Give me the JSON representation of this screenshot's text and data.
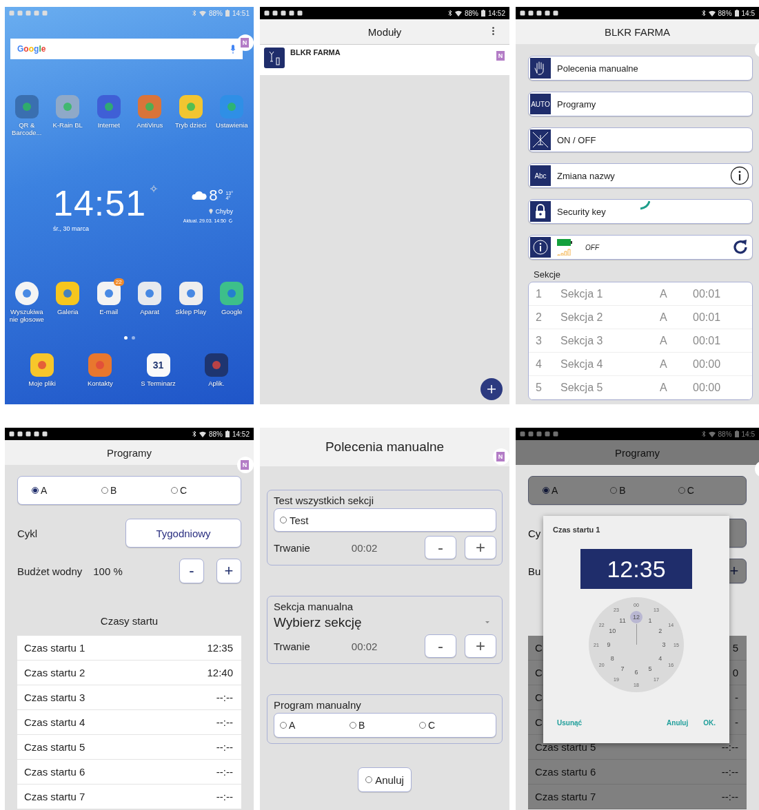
{
  "home_screen": {
    "status_bar": {
      "battery": "88%",
      "time": "14:51"
    },
    "overlay_bubble": "N",
    "search": {
      "logo": "Google"
    },
    "apps": [
      {
        "label": "QR &\nBarcode...",
        "color": "#3a6fb0"
      },
      {
        "label": "K-Rain BL",
        "color": "#8fa9c8"
      },
      {
        "label": "Internet",
        "color": "#3f5fd6"
      },
      {
        "label": "AntiVirus",
        "color": "#d9743a"
      },
      {
        "label": "Tryb dzieci",
        "color": "#f2c531"
      },
      {
        "label": "Ustawienia",
        "color": "#2f8fe6"
      }
    ],
    "clock": {
      "time": "14:51",
      "date": "śr., 30 marca"
    },
    "weather": {
      "temperature": "8°",
      "high": "13°",
      "low": "4°",
      "location": "Chyby",
      "updated": "Aktual. 29.03. 14:50"
    },
    "dock_apps": [
      {
        "label": "Wyszukiwa\nnie głosowe",
        "color": "#f4f4f4"
      },
      {
        "label": "Galeria",
        "color": "#f6c61e"
      },
      {
        "label": "E-mail",
        "color": "#f3f3f3",
        "badge": "22"
      },
      {
        "label": "Aparat",
        "color": "#e6e9ee"
      },
      {
        "label": "Sklep Play",
        "color": "#eeeeee"
      },
      {
        "label": "Google",
        "color": "#3dbf8a"
      }
    ],
    "page_dots": [
      {
        "selected": true
      },
      {
        "selected": false
      }
    ],
    "hotseat": [
      {
        "label": "Moje pliki",
        "color": "#f7c62b"
      },
      {
        "label": "Kontakty",
        "color": "#e8772e"
      },
      {
        "label": "S Terminarz",
        "color": "#fafafa",
        "icon_text": "31"
      },
      {
        "label": "Aplik.",
        "color": "#1e3570"
      }
    ]
  },
  "modules_screen": {
    "status_bar": {
      "battery": "88%",
      "time": "14:52"
    },
    "title": "Moduły",
    "overlay_bubble": "N",
    "modules": [
      {
        "name": "BLKR FARMA"
      }
    ]
  },
  "device_screen": {
    "status_bar": {
      "battery": "88%",
      "time": "14:5"
    },
    "title": "BLKR FARMA",
    "menu": [
      {
        "kind": "hand",
        "label": "Polecenia manualne",
        "info": false,
        "loading": false
      },
      {
        "kind": "text",
        "icon_text": "AUTO",
        "label": "Programy",
        "info": false,
        "loading": false
      },
      {
        "kind": "sprinkler",
        "label": "ON / OFF",
        "info": false,
        "loading": false
      },
      {
        "kind": "text",
        "icon_text": "Abc",
        "label": "Zmiana nazwy",
        "info": true,
        "loading": false
      },
      {
        "kind": "lock",
        "label": "Security key",
        "info": false,
        "loading": true
      }
    ],
    "status": {
      "state": "OFF"
    },
    "sections_label": "Sekcje",
    "sections": [
      {
        "number": "1",
        "name": "Sekcja 1",
        "program": "A",
        "time": "00:01"
      },
      {
        "number": "2",
        "name": "Sekcja 2",
        "program": "A",
        "time": "00:01"
      },
      {
        "number": "3",
        "name": "Sekcja 3",
        "program": "A",
        "time": "00:01"
      },
      {
        "number": "4",
        "name": "Sekcja 4",
        "program": "A",
        "time": "00:00"
      },
      {
        "number": "5",
        "name": "Sekcja 5",
        "program": "A",
        "time": "00:00"
      }
    ]
  },
  "programs_screen": {
    "status_bar": {
      "battery": "88%",
      "time": "14:52"
    },
    "title": "Programy",
    "overlay_bubble": "N",
    "programs": [
      {
        "label": "A",
        "selected": true
      },
      {
        "label": "B",
        "selected": false
      },
      {
        "label": "C",
        "selected": false
      }
    ],
    "cycle": {
      "label": "Cykl",
      "value": "Tygodniowy"
    },
    "budget": {
      "label": "Budżet wodny",
      "value": "100 %",
      "minus": "-",
      "plus": "+"
    },
    "start_times_title": "Czasy startu",
    "start_times": [
      {
        "label": "Czas startu 1",
        "time": "12:35"
      },
      {
        "label": "Czas startu 2",
        "time": "12:40"
      },
      {
        "label": "Czas startu 3",
        "time": "--:--"
      },
      {
        "label": "Czas startu 4",
        "time": "--:--"
      },
      {
        "label": "Czas startu 5",
        "time": "--:--"
      },
      {
        "label": "Czas startu 6",
        "time": "--:--"
      },
      {
        "label": "Czas startu 7",
        "time": "--:--"
      }
    ]
  },
  "manual_screen": {
    "title": "Polecenia manualne",
    "overlay_bubble": "N",
    "test_group": {
      "title": "Test wszystkich sekcji",
      "option": {
        "label": "Test",
        "selected": false
      },
      "duration_label": "Trwanie",
      "duration": "00:02",
      "minus": "-",
      "plus": "+"
    },
    "section_group": {
      "title": "Sekcja manualna",
      "dropdown": {
        "value": "Wybierz sekcję"
      },
      "duration_label": "Trwanie",
      "duration": "00:02",
      "minus": "-",
      "plus": "+"
    },
    "program_group": {
      "title": "Program manualny",
      "programs": [
        {
          "label": "A",
          "selected": false
        },
        {
          "label": "B",
          "selected": false
        },
        {
          "label": "C",
          "selected": false
        }
      ]
    },
    "cancel": {
      "label": "Anuluj",
      "selected": false
    }
  },
  "time_dialog_screen": {
    "status_bar": {
      "battery": "88%",
      "time": "14:5"
    },
    "title": "Programy",
    "programs": [
      {
        "label": "A",
        "selected": true
      },
      {
        "label": "B",
        "selected": false
      },
      {
        "label": "C",
        "selected": false
      }
    ],
    "cycle": {
      "label": "Cy"
    },
    "budget": {
      "label": "Bu",
      "plus": "+"
    },
    "start_times": [
      {
        "label": "C",
        "time": "5"
      },
      {
        "label": "C",
        "time": "0"
      },
      {
        "label": "C",
        "time": "-"
      },
      {
        "label": "C",
        "time": "-"
      },
      {
        "label": "Czas startu 5",
        "time": "--:--"
      },
      {
        "label": "Czas startu 6",
        "time": "--:--"
      },
      {
        "label": "Czas startu 7",
        "time": "--:--"
      }
    ],
    "dialog": {
      "title": "Czas startu 1",
      "time": "12:35",
      "outer": [
        "00",
        "13",
        "14",
        "15",
        "16",
        "17",
        "18",
        "19",
        "20",
        "21",
        "22",
        "23"
      ],
      "inner": [
        {
          "label": "12",
          "selected": true
        },
        {
          "label": "1",
          "selected": false
        },
        {
          "label": "2",
          "selected": false
        },
        {
          "label": "3",
          "selected": false
        },
        {
          "label": "4",
          "selected": false
        },
        {
          "label": "5",
          "selected": false
        },
        {
          "label": "6",
          "selected": false
        },
        {
          "label": "7",
          "selected": false
        },
        {
          "label": "8",
          "selected": false
        },
        {
          "label": "9",
          "selected": false
        },
        {
          "label": "10",
          "selected": false
        },
        {
          "label": "11",
          "selected": false
        }
      ],
      "delete": "Usunąć",
      "cancel": "Anuluj",
      "ok": "OK."
    }
  }
}
